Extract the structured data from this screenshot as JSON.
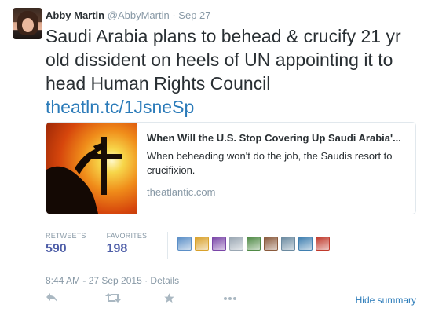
{
  "tweet": {
    "name": "Abby Martin",
    "handle": "@AbbyMartin",
    "separator": "·",
    "date": "Sep 27",
    "text": "Saudi Arabia plans to behead & crucify 21 yr old dissident on heels of UN appointing it to head Human Rights Council",
    "link": "theatln.tc/1JsneSp"
  },
  "card": {
    "title": "When Will the U.S. Stop Covering Up Saudi Arabia'...",
    "description": "When beheading won't do the job, the Saudis resort to crucifixion.",
    "domain": "theatlantic.com"
  },
  "stats": {
    "retweets_label": "RETWEETS",
    "retweets_value": "590",
    "favorites_label": "FAVORITES",
    "favorites_value": "198"
  },
  "favoriters": [
    {
      "icon": "avatar-icon",
      "color": "#5b8fc7"
    },
    {
      "icon": "avatar-icon",
      "color": "#d9a12a"
    },
    {
      "icon": "avatar-icon",
      "color": "#7a46a8"
    },
    {
      "icon": "avatar-icon",
      "color": "#9aa7b3"
    },
    {
      "icon": "avatar-icon",
      "color": "#4f8a45"
    },
    {
      "icon": "avatar-icon",
      "color": "#8a5a3c"
    },
    {
      "icon": "avatar-icon",
      "color": "#6b8aa0"
    },
    {
      "icon": "avatar-icon",
      "color": "#3f7fb0"
    },
    {
      "icon": "avatar-icon",
      "color": "#c0392b"
    }
  ],
  "timestamp": "8:44 AM - 27 Sep 2015 · Details",
  "actions": {
    "reply_icon": "reply-icon",
    "retweet_icon": "retweet-icon",
    "favorite_icon": "star-icon",
    "more_icon": "more-icon",
    "hide_summary": "Hide summary"
  }
}
